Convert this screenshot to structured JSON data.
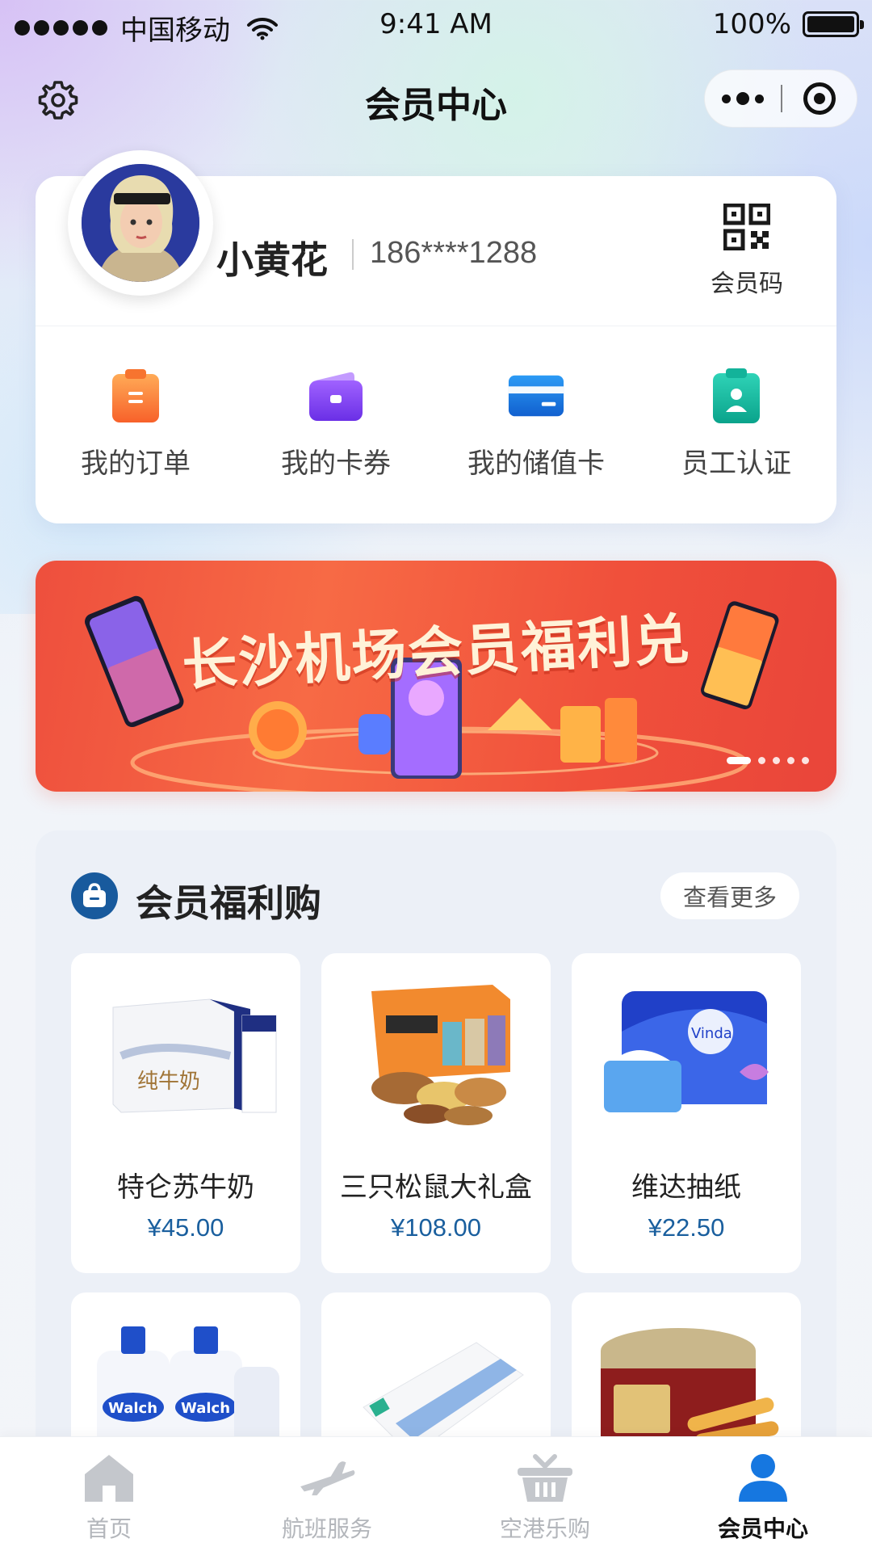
{
  "status_bar": {
    "carrier": "中国移动",
    "time": "9:41 AM",
    "battery": "100%"
  },
  "nav": {
    "title": "会员中心",
    "icons": [
      "settings-icon",
      "more-icon",
      "target-icon"
    ]
  },
  "profile": {
    "name": "小黄花",
    "phone": "186****1288",
    "member_code_label": "会员码"
  },
  "quick_menu": [
    {
      "label": "我的订单",
      "icon": "order-icon",
      "color": "#f7742f"
    },
    {
      "label": "我的卡券",
      "icon": "coupon-wallet-icon",
      "color": "#7b3df0"
    },
    {
      "label": "我的储值卡",
      "icon": "stored-value-card-icon",
      "color": "#1677e0"
    },
    {
      "label": "员工认证",
      "icon": "employee-badge-icon",
      "color": "#13b39a"
    }
  ],
  "banner": {
    "title": "长沙机场会员福利兑",
    "slide_count": 5,
    "active_slide": 1
  },
  "shop": {
    "title": "会员福利购",
    "see_more": "查看更多",
    "products": [
      {
        "name": "特仑苏牛奶",
        "price": "¥45.00",
        "image": "milk-box-image"
      },
      {
        "name": "三只松鼠大礼盒",
        "price": "¥108.00",
        "image": "snack-gift-box-image"
      },
      {
        "name": "维达抽纸",
        "price": "¥22.50",
        "image": "tissue-pack-image"
      },
      {
        "name": "",
        "price": "",
        "image": "laundry-detergent-image"
      },
      {
        "name": "",
        "price": "",
        "image": "towel-image"
      },
      {
        "name": "",
        "price": "",
        "image": "egg-roll-tin-image"
      }
    ]
  },
  "tab_bar": {
    "tabs": [
      {
        "label": "首页",
        "icon": "home-icon",
        "active": false
      },
      {
        "label": "航班服务",
        "icon": "airplane-icon",
        "active": false
      },
      {
        "label": "空港乐购",
        "icon": "shopping-basket-icon",
        "active": false
      },
      {
        "label": "会员中心",
        "icon": "user-icon",
        "active": true
      }
    ]
  },
  "colors": {
    "accent_blue": "#1a5f9e",
    "active_tab": "#1677e0",
    "inactive_tab": "#b3b6bb",
    "banner_red": "#ee4f3d"
  }
}
